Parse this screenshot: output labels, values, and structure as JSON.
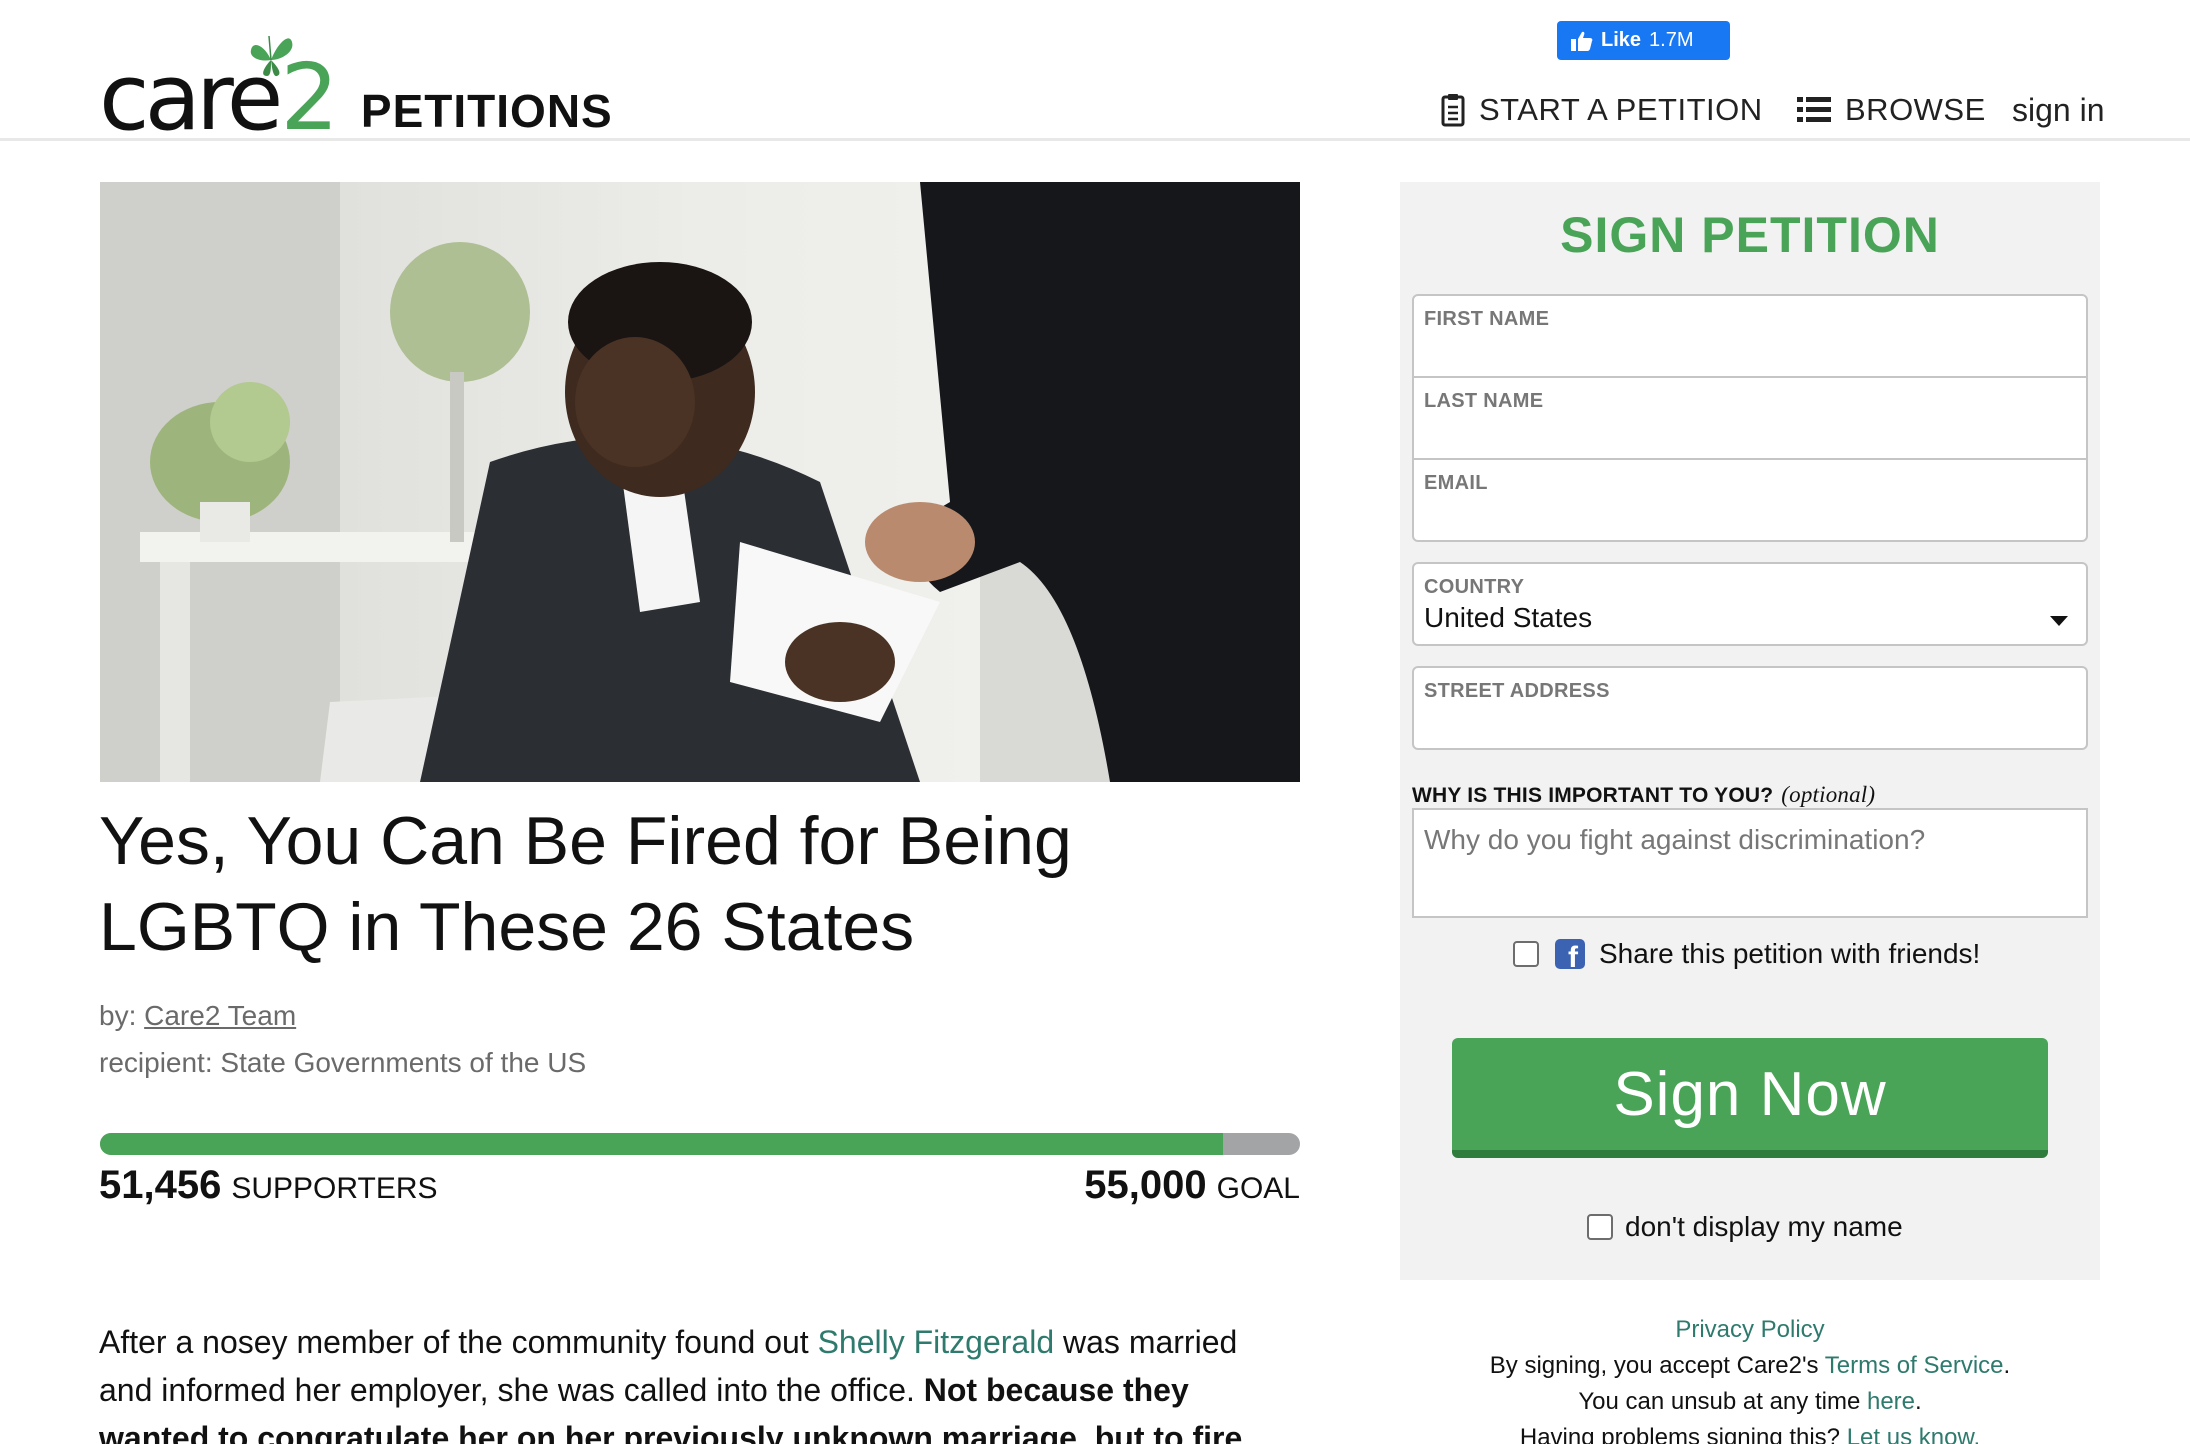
{
  "header": {
    "logo_care": "care",
    "logo_two": "2",
    "logo_petitions": "PETITIONS",
    "fb_like_label": "Like",
    "fb_like_count": "1.7M",
    "nav": {
      "start": "START A PETITION",
      "browse": "BROWSE",
      "signin": "sign in"
    }
  },
  "petition": {
    "title_line1": "Yes, You Can Be Fired for Being",
    "title_line2": "LGBTQ in These 26 States",
    "by_label": "by:",
    "author": "Care2 Team",
    "recipient_label": "recipient:",
    "recipient": "State Governments of the US",
    "supporters_count": "51,456",
    "supporters_label": "SUPPORTERS",
    "goal_count": "55,000",
    "goal_label": "GOAL",
    "progress_fraction": 0.9356,
    "body": {
      "p1_start": "After a nosey member of the community found out ",
      "p1_link": "Shelly Fitzgerald",
      "p1_mid": " was married and informed her employer, she was called into the office. ",
      "p1_bold": "Not because they ",
      "p1_bold_underline": "wanted to congratulate her on her previously unknown marriage, but to fire her —"
    }
  },
  "form": {
    "title": "SIGN PETITION",
    "first_name_label": "FIRST NAME",
    "last_name_label": "LAST NAME",
    "email_label": "EMAIL",
    "country_label": "COUNTRY",
    "country_value": "United States",
    "street_label": "STREET ADDRESS",
    "why_label": "WHY IS THIS IMPORTANT TO YOU?",
    "why_optional": "(optional)",
    "why_placeholder": "Why do you fight against discrimination?",
    "share_label": "Share this petition with friends!",
    "sign_button": "Sign Now",
    "dont_display_label": "don't display my name"
  },
  "legal": {
    "privacy": "Privacy Policy",
    "accept_prefix": "By signing, you accept Care2's ",
    "terms": "Terms of Service",
    "accept_suffix": ".",
    "unsub_prefix": "You can unsub at any time ",
    "unsub_link": "here",
    "unsub_suffix": ".",
    "problems_prefix": "Having problems signing this? ",
    "problems_link": "Let us know."
  },
  "colors": {
    "brand_green": "#4aa457",
    "link_teal": "#2e7a6d",
    "facebook_blue": "#1877f2"
  },
  "icons": [
    "butterfly-icon",
    "thumbs-up-icon",
    "clipboard-icon",
    "list-icon",
    "chevron-down-icon",
    "facebook-icon"
  ]
}
